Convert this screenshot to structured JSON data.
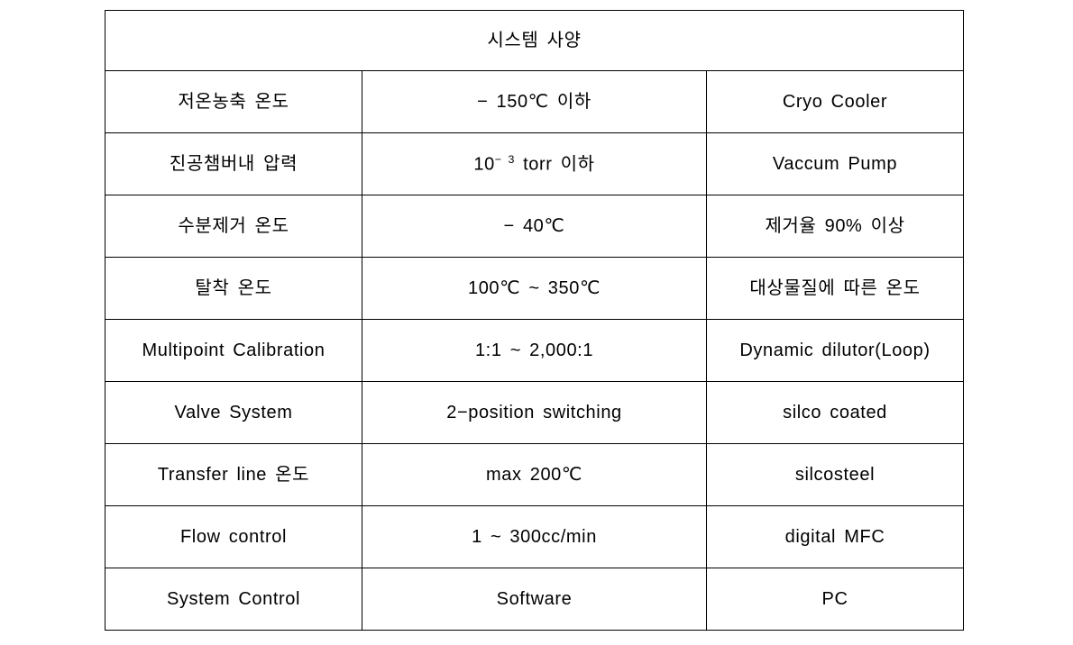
{
  "table": {
    "title": "시스템 사양",
    "columns": 3,
    "rows": [
      {
        "item": "저온농축 온도",
        "spec": "− 150℃ 이하",
        "remark": "Cryo Cooler"
      },
      {
        "item": "진공챔버내 압력",
        "spec_prefix": "10",
        "spec_superscript": "− 3",
        "spec_suffix": " torr 이하",
        "spec": "10⁻³ torr 이하",
        "remark": "Vaccum Pump"
      },
      {
        "item": "수분제거 온도",
        "spec": "− 40℃",
        "remark": "제거율 90% 이상"
      },
      {
        "item": "탈착 온도",
        "spec": "100℃ ~ 350℃",
        "remark": "대상물질에 따른 온도"
      },
      {
        "item": "Multipoint Calibration",
        "spec": "1:1 ~ 2,000:1",
        "remark": "Dynamic dilutor(Loop)"
      },
      {
        "item": "Valve System",
        "spec": "2−position switching",
        "remark": "silco coated"
      },
      {
        "item": "Transfer line 온도",
        "spec": "max 200℃",
        "remark": "silcosteel"
      },
      {
        "item": "Flow control",
        "spec": "1 ~ 300cc/min",
        "remark": "digital MFC"
      },
      {
        "item": "System Control",
        "spec": "Software",
        "remark": "PC"
      }
    ]
  },
  "colors": {
    "background": "#ffffff",
    "text": "#000000",
    "border": "#000000"
  }
}
